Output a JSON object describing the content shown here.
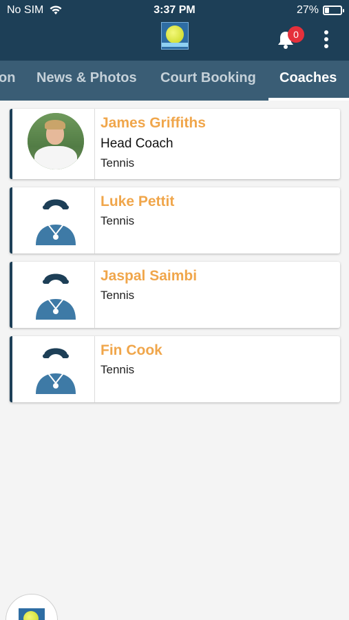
{
  "status_bar": {
    "carrier": "No SIM",
    "time": "3:37 PM",
    "battery_text": "27%",
    "battery_level": 0.27
  },
  "header": {
    "logo_icon": "tennis-club-logo",
    "notifications_count": "0",
    "colors": {
      "header_bg": "#1d3f57",
      "tabs_bg": "#3a5d75",
      "badge": "#e5303b"
    }
  },
  "tabs": [
    {
      "label": "on",
      "active": false
    },
    {
      "label": "News & Photos",
      "active": false
    },
    {
      "label": "Court Booking",
      "active": false
    },
    {
      "label": "Coaches",
      "active": true
    }
  ],
  "coaches": [
    {
      "name": "James Griffiths",
      "role": "Head Coach",
      "sport": "Tennis",
      "image": "photo"
    },
    {
      "name": "Luke Pettit",
      "sport": "Tennis",
      "image": "placeholder-coach-icon"
    },
    {
      "name": "Jaspal Saimbi",
      "sport": "Tennis",
      "image": "placeholder-coach-icon"
    },
    {
      "name": "Fin Cook",
      "sport": "Tennis",
      "image": "placeholder-coach-icon"
    }
  ],
  "accent": {
    "name_color": "#f0a64b",
    "card_border": "#1d3f57"
  }
}
